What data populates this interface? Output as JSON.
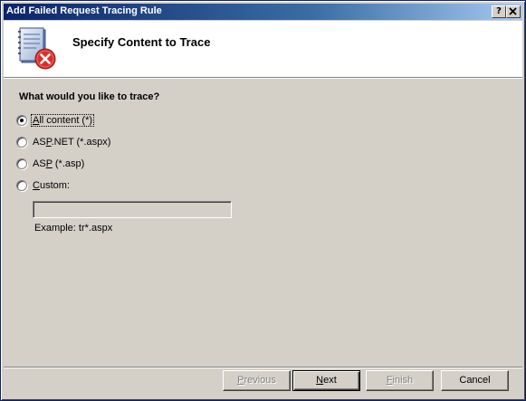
{
  "window": {
    "title": "Add Failed Request Tracing Rule",
    "help_button": "?",
    "close_button": "X"
  },
  "header": {
    "title": "Specify Content to Trace",
    "icon": "document-error-icon"
  },
  "main": {
    "question": "What would you like to trace?",
    "options": [
      {
        "pre": "",
        "key": "A",
        "post": "ll content (*)",
        "checked": true
      },
      {
        "pre": "AS",
        "key": "P",
        "post": ".NET (*.aspx)",
        "checked": false
      },
      {
        "pre": "AS",
        "key": "P",
        "post": " (*.asp)",
        "checked": false
      },
      {
        "pre": "",
        "key": "C",
        "post": "ustom:",
        "checked": false
      }
    ],
    "custom_value": "",
    "example": "Example: tr*.aspx"
  },
  "footer": {
    "previous": {
      "pre": "",
      "key": "P",
      "post": "revious"
    },
    "next": {
      "pre": "",
      "key": "N",
      "post": "ext"
    },
    "finish": {
      "pre": "",
      "key": "F",
      "post": "inish"
    },
    "cancel": "Cancel"
  },
  "colors": {
    "titlebar_start": "#0a246a",
    "titlebar_end": "#a6caf0",
    "dialog_face": "#d4d0c8",
    "error_red": "#d9302a"
  }
}
